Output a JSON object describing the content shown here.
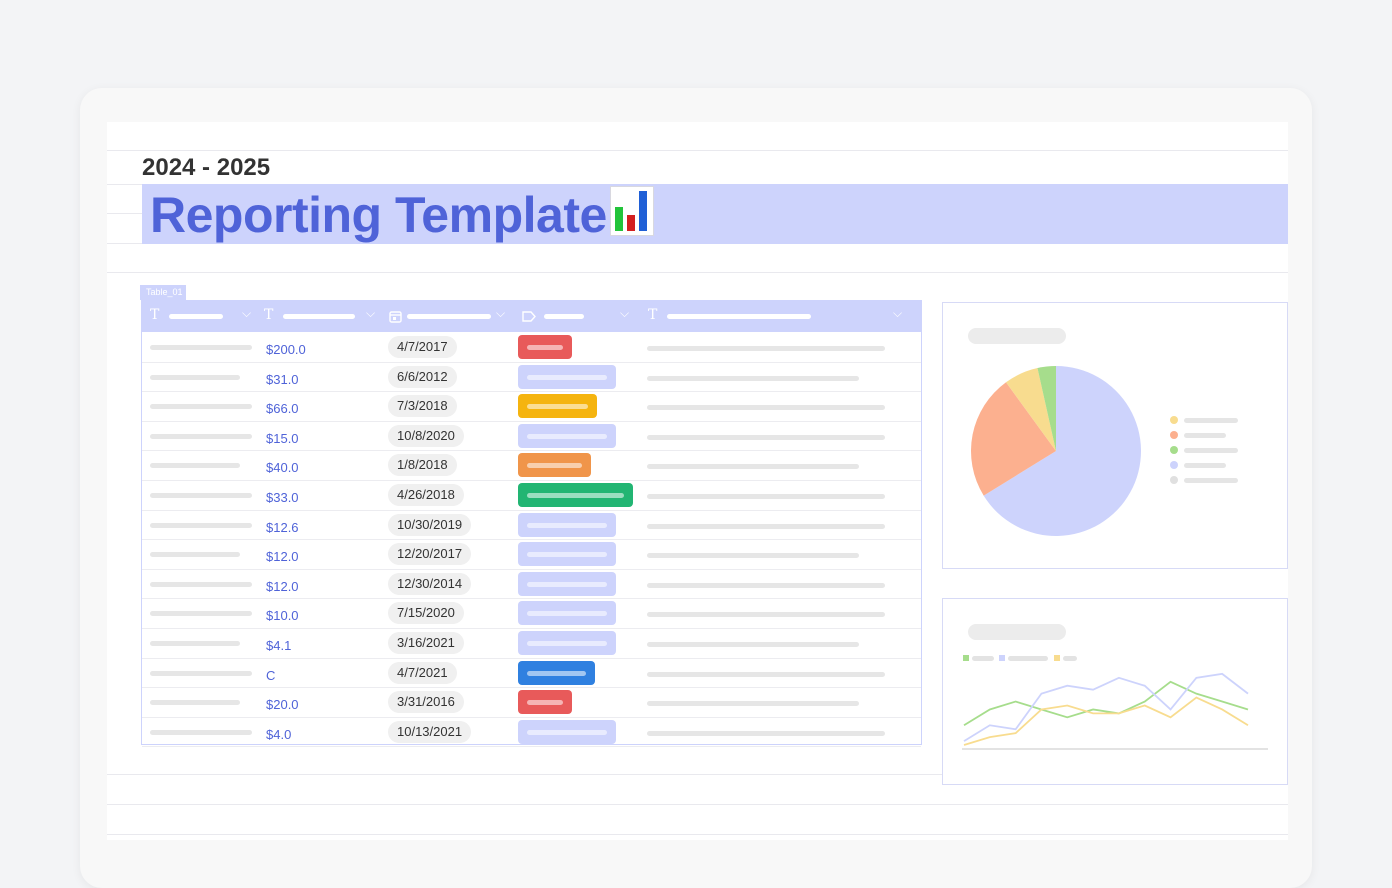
{
  "header": {
    "year_range": "2024 - 2025",
    "title": "Reporting Template",
    "title_icon": "bar-chart-emoji-icon"
  },
  "table": {
    "tag": "Table_01",
    "columns": [
      {
        "type_icon": "text-type-icon"
      },
      {
        "type_icon": "text-type-icon"
      },
      {
        "type_icon": "calendar-type-icon"
      },
      {
        "type_icon": "label-type-icon"
      },
      {
        "type_icon": "text-type-icon"
      }
    ],
    "rows": [
      {
        "amount": "$200.0",
        "date": "4/7/2017",
        "tag_color": "#e85a5a"
      },
      {
        "amount": "$31.0",
        "date": "6/6/2012",
        "tag_color": "#cdd3fc"
      },
      {
        "amount": "$66.0",
        "date": "7/3/2018",
        "tag_color": "#f5b40f"
      },
      {
        "amount": "$15.0",
        "date": "10/8/2020",
        "tag_color": "#cdd3fc"
      },
      {
        "amount": "$40.0",
        "date": "1/8/2018",
        "tag_color": "#f0954a"
      },
      {
        "amount": "$33.0",
        "date": "4/26/2018",
        "tag_color": "#22b573"
      },
      {
        "amount": "$12.6",
        "date": "10/30/2019",
        "tag_color": "#cdd3fc"
      },
      {
        "amount": "$12.0",
        "date": "12/20/2017",
        "tag_color": "#cdd3fc"
      },
      {
        "amount": "$12.0",
        "date": "12/30/2014",
        "tag_color": "#cdd3fc"
      },
      {
        "amount": "$10.0",
        "date": "7/15/2020",
        "tag_color": "#cdd3fc"
      },
      {
        "amount": "$4.1",
        "date": "3/16/2021",
        "tag_color": "#cdd3fc"
      },
      {
        "amount": "C",
        "date": "4/7/2021",
        "tag_color": "#2f80e0"
      },
      {
        "amount": "$20.0",
        "date": "3/31/2016",
        "tag_color": "#e85a5a"
      },
      {
        "amount": "$4.0",
        "date": "10/13/2021",
        "tag_color": "#cdd3fc"
      }
    ]
  },
  "chart_data": [
    {
      "type": "pie",
      "title": "",
      "slices": [
        {
          "value": 0.662,
          "color": "#cdd3fc"
        },
        {
          "value": 0.238,
          "color": "#fcb08f"
        },
        {
          "value": 0.065,
          "color": "#f8dc8f"
        },
        {
          "value": 0.035,
          "color": "#a6dd8c"
        }
      ],
      "legend_colors": [
        "#f8dc8f",
        "#fcb08f",
        "#a6dd8c",
        "#cdd3fc",
        "#e0e0e0"
      ],
      "legend_placement": "right"
    },
    {
      "type": "line",
      "title": "",
      "series": [
        {
          "color": "#a6dd8c",
          "values": [
            3,
            5,
            6,
            5,
            4,
            5,
            4.5,
            6,
            8.5,
            7,
            6,
            5
          ]
        },
        {
          "color": "#cdd3fc",
          "values": [
            1,
            3,
            2.5,
            7,
            8,
            7.5,
            9,
            8,
            5,
            9,
            9.5,
            7
          ]
        },
        {
          "color": "#f8dc8f",
          "values": [
            0.5,
            1.5,
            2,
            5,
            5.5,
            4.5,
            4.5,
            5.5,
            4,
            6.5,
            5,
            3
          ]
        }
      ],
      "ylim": [
        0,
        11
      ],
      "legend_colors": [
        "#a6dd8c",
        "#cdd3fc",
        "#f8dc8f"
      ],
      "legend_placement": "top-left",
      "grid": false
    }
  ]
}
